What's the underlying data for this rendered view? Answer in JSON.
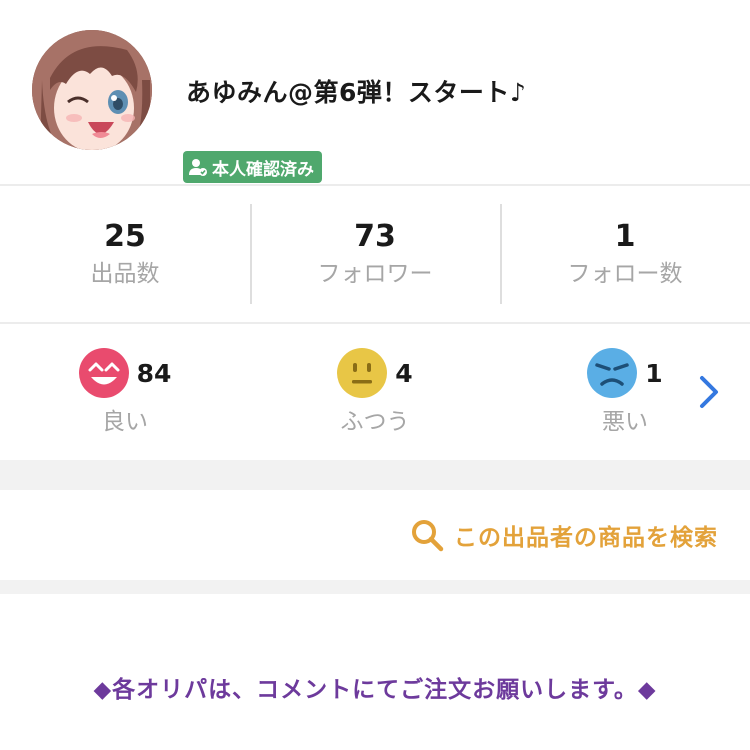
{
  "profile": {
    "username": "あゆみん@第6弾！スタート♪",
    "verified_label": "本人確認済み",
    "avatar": "avatar-anime-girl-winking"
  },
  "stats": [
    {
      "value": "25",
      "label": "出品数"
    },
    {
      "value": "73",
      "label": "フォロワー"
    },
    {
      "value": "1",
      "label": "フォロー数"
    }
  ],
  "ratings": [
    {
      "count": "84",
      "label": "良い",
      "icon": "good-face-icon",
      "color": "#e94b6e"
    },
    {
      "count": "4",
      "label": "ふつう",
      "icon": "neutral-face-icon",
      "color": "#e8c646"
    },
    {
      "count": "1",
      "label": "悪い",
      "icon": "bad-face-icon",
      "color": "#5aaee5"
    }
  ],
  "ratings_arrow_icon": "chevron-right-icon",
  "search": {
    "label": "この出品者の商品を検索",
    "icon": "search-icon",
    "color": "#e3a23a"
  },
  "comment": "◆各オリパは、コメントにてご注文お願いします。◆",
  "colors": {
    "verified_badge": "#4fa86d",
    "comment_text": "#6d3a9c",
    "arrow": "#3478e0"
  }
}
